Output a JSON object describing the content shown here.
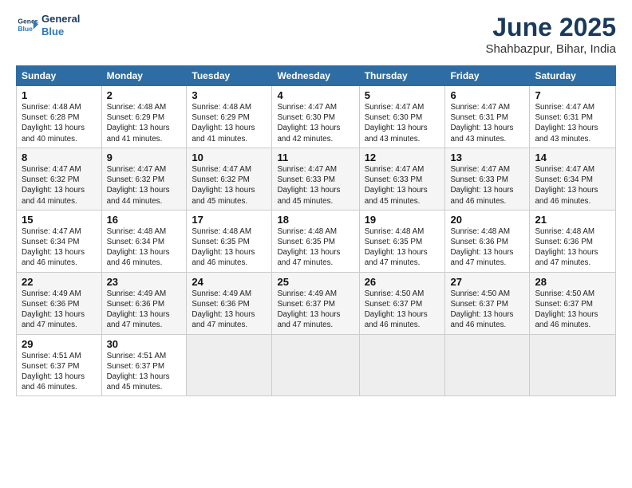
{
  "header": {
    "logo_line1": "General",
    "logo_line2": "Blue",
    "month": "June 2025",
    "location": "Shahbazpur, Bihar, India"
  },
  "days_of_week": [
    "Sunday",
    "Monday",
    "Tuesday",
    "Wednesday",
    "Thursday",
    "Friday",
    "Saturday"
  ],
  "weeks": [
    [
      {
        "day": "1",
        "info": "Sunrise: 4:48 AM\nSunset: 6:28 PM\nDaylight: 13 hours\nand 40 minutes."
      },
      {
        "day": "2",
        "info": "Sunrise: 4:48 AM\nSunset: 6:29 PM\nDaylight: 13 hours\nand 41 minutes."
      },
      {
        "day": "3",
        "info": "Sunrise: 4:48 AM\nSunset: 6:29 PM\nDaylight: 13 hours\nand 41 minutes."
      },
      {
        "day": "4",
        "info": "Sunrise: 4:47 AM\nSunset: 6:30 PM\nDaylight: 13 hours\nand 42 minutes."
      },
      {
        "day": "5",
        "info": "Sunrise: 4:47 AM\nSunset: 6:30 PM\nDaylight: 13 hours\nand 43 minutes."
      },
      {
        "day": "6",
        "info": "Sunrise: 4:47 AM\nSunset: 6:31 PM\nDaylight: 13 hours\nand 43 minutes."
      },
      {
        "day": "7",
        "info": "Sunrise: 4:47 AM\nSunset: 6:31 PM\nDaylight: 13 hours\nand 43 minutes."
      }
    ],
    [
      {
        "day": "8",
        "info": "Sunrise: 4:47 AM\nSunset: 6:32 PM\nDaylight: 13 hours\nand 44 minutes."
      },
      {
        "day": "9",
        "info": "Sunrise: 4:47 AM\nSunset: 6:32 PM\nDaylight: 13 hours\nand 44 minutes."
      },
      {
        "day": "10",
        "info": "Sunrise: 4:47 AM\nSunset: 6:32 PM\nDaylight: 13 hours\nand 45 minutes."
      },
      {
        "day": "11",
        "info": "Sunrise: 4:47 AM\nSunset: 6:33 PM\nDaylight: 13 hours\nand 45 minutes."
      },
      {
        "day": "12",
        "info": "Sunrise: 4:47 AM\nSunset: 6:33 PM\nDaylight: 13 hours\nand 45 minutes."
      },
      {
        "day": "13",
        "info": "Sunrise: 4:47 AM\nSunset: 6:33 PM\nDaylight: 13 hours\nand 46 minutes."
      },
      {
        "day": "14",
        "info": "Sunrise: 4:47 AM\nSunset: 6:34 PM\nDaylight: 13 hours\nand 46 minutes."
      }
    ],
    [
      {
        "day": "15",
        "info": "Sunrise: 4:47 AM\nSunset: 6:34 PM\nDaylight: 13 hours\nand 46 minutes."
      },
      {
        "day": "16",
        "info": "Sunrise: 4:48 AM\nSunset: 6:34 PM\nDaylight: 13 hours\nand 46 minutes."
      },
      {
        "day": "17",
        "info": "Sunrise: 4:48 AM\nSunset: 6:35 PM\nDaylight: 13 hours\nand 46 minutes."
      },
      {
        "day": "18",
        "info": "Sunrise: 4:48 AM\nSunset: 6:35 PM\nDaylight: 13 hours\nand 47 minutes."
      },
      {
        "day": "19",
        "info": "Sunrise: 4:48 AM\nSunset: 6:35 PM\nDaylight: 13 hours\nand 47 minutes."
      },
      {
        "day": "20",
        "info": "Sunrise: 4:48 AM\nSunset: 6:36 PM\nDaylight: 13 hours\nand 47 minutes."
      },
      {
        "day": "21",
        "info": "Sunrise: 4:48 AM\nSunset: 6:36 PM\nDaylight: 13 hours\nand 47 minutes."
      }
    ],
    [
      {
        "day": "22",
        "info": "Sunrise: 4:49 AM\nSunset: 6:36 PM\nDaylight: 13 hours\nand 47 minutes."
      },
      {
        "day": "23",
        "info": "Sunrise: 4:49 AM\nSunset: 6:36 PM\nDaylight: 13 hours\nand 47 minutes."
      },
      {
        "day": "24",
        "info": "Sunrise: 4:49 AM\nSunset: 6:36 PM\nDaylight: 13 hours\nand 47 minutes."
      },
      {
        "day": "25",
        "info": "Sunrise: 4:49 AM\nSunset: 6:37 PM\nDaylight: 13 hours\nand 47 minutes."
      },
      {
        "day": "26",
        "info": "Sunrise: 4:50 AM\nSunset: 6:37 PM\nDaylight: 13 hours\nand 46 minutes."
      },
      {
        "day": "27",
        "info": "Sunrise: 4:50 AM\nSunset: 6:37 PM\nDaylight: 13 hours\nand 46 minutes."
      },
      {
        "day": "28",
        "info": "Sunrise: 4:50 AM\nSunset: 6:37 PM\nDaylight: 13 hours\nand 46 minutes."
      }
    ],
    [
      {
        "day": "29",
        "info": "Sunrise: 4:51 AM\nSunset: 6:37 PM\nDaylight: 13 hours\nand 46 minutes."
      },
      {
        "day": "30",
        "info": "Sunrise: 4:51 AM\nSunset: 6:37 PM\nDaylight: 13 hours\nand 45 minutes."
      },
      null,
      null,
      null,
      null,
      null
    ]
  ]
}
